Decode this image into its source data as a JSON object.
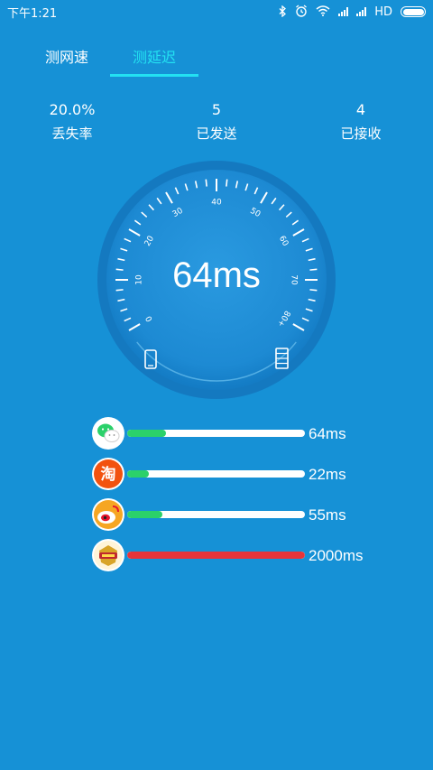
{
  "status_bar": {
    "time": "下午1:21",
    "network": "HD",
    "icons": [
      "bluetooth-icon",
      "alarm-icon",
      "wifi-icon",
      "signal-icon",
      "signal-icon",
      "battery-icon"
    ]
  },
  "tabs": [
    {
      "label": "测网速",
      "active": false
    },
    {
      "label": "测延迟",
      "active": true
    }
  ],
  "colors": {
    "background": "#1691d6",
    "accent": "#23e1f2",
    "good": "#2bd16a",
    "bad": "#e7343a"
  },
  "stats": [
    {
      "value": "20.0%",
      "label": "丢失率"
    },
    {
      "value": "5",
      "label": "已发送"
    },
    {
      "value": "4",
      "label": "已接收"
    }
  ],
  "gauge": {
    "value_text": "64ms",
    "scale": [
      "0",
      "10",
      "20",
      "30",
      "40",
      "50",
      "60",
      "70",
      "80+"
    ],
    "scale_max": 80,
    "value_ms": 64,
    "left_icon": "phone-icon",
    "right_icon": "server-icon"
  },
  "pings": [
    {
      "app": "wechat",
      "icon": "wechat-icon",
      "value": "64ms",
      "level": 0.22,
      "status": "good"
    },
    {
      "app": "taobao",
      "icon": "taobao-icon",
      "value": "22ms",
      "level": 0.12,
      "status": "good"
    },
    {
      "app": "weibo",
      "icon": "weibo-icon",
      "value": "55ms",
      "level": 0.2,
      "status": "good"
    },
    {
      "app": "game",
      "icon": "game-icon",
      "value": "2000ms",
      "level": 1.0,
      "status": "bad"
    }
  ]
}
